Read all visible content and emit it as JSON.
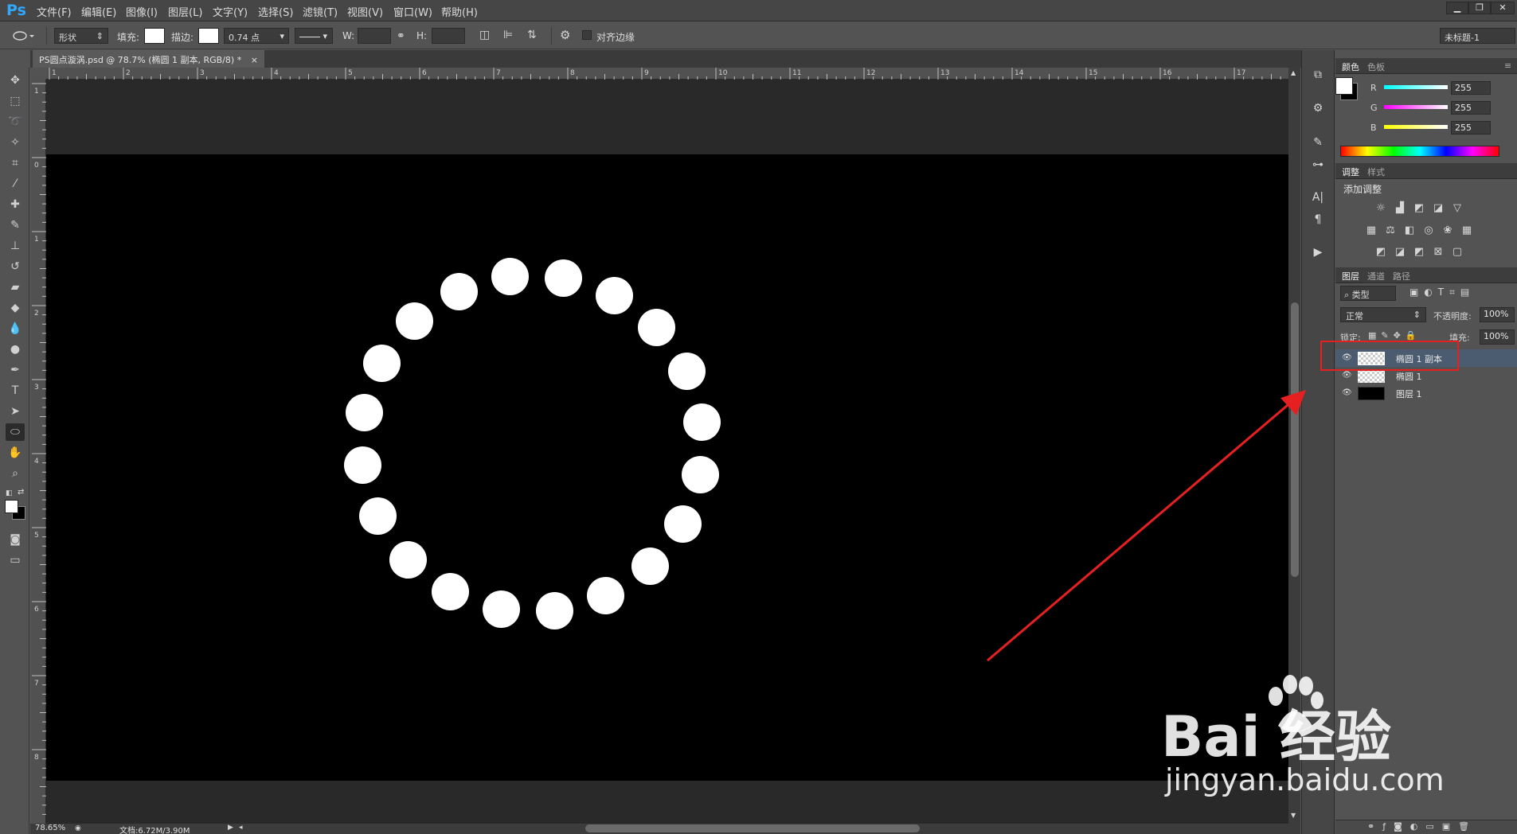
{
  "app": {
    "logo": "Ps"
  },
  "menu": [
    "文件(F)",
    "编辑(E)",
    "图像(I)",
    "图层(L)",
    "文字(Y)",
    "选择(S)",
    "滤镜(T)",
    "视图(V)",
    "窗口(W)",
    "帮助(H)"
  ],
  "window_controls": [
    "▁",
    "❐",
    "✕"
  ],
  "options": {
    "mode": "形状",
    "fill_label": "填充:",
    "stroke_label": "描边:",
    "stroke_width": "0.74 点",
    "w_label": "W:",
    "h_label": "H:",
    "align_edges": "对齐边缘",
    "workspace": "未标题-1"
  },
  "document": {
    "tab_title": "PS圆点漩涡.psd @ 78.7% (椭圆 1 副本, RGB/8) *",
    "close": "×",
    "zoom": "78.65%",
    "doc_size": "文档:6.72M/3.90M"
  },
  "ruler": {
    "horizontal": [
      "1",
      "2",
      "3",
      "4",
      "5",
      "6",
      "7",
      "8",
      "9",
      "10",
      "11",
      "12",
      "13",
      "14",
      "15",
      "16",
      "17"
    ],
    "vertical": [
      "1",
      "0",
      "1",
      "2",
      "3",
      "4",
      "5",
      "6",
      "7",
      "8"
    ]
  },
  "color_panel": {
    "tabs": [
      "颜色",
      "色板"
    ],
    "channels": [
      {
        "label": "R",
        "value": "255"
      },
      {
        "label": "G",
        "value": "255"
      },
      {
        "label": "B",
        "value": "255"
      }
    ]
  },
  "adjust_panel": {
    "tabs": [
      "调整",
      "样式"
    ],
    "title": "添加调整"
  },
  "layers_panel": {
    "tabs": [
      "图层",
      "通道",
      "路径"
    ],
    "filter_kind": "类型",
    "blend_mode": "正常",
    "opacity_label": "不透明度:",
    "opacity": "100%",
    "lock_label": "锁定:",
    "fill_label": "填充:",
    "fill": "100%",
    "layers": [
      {
        "name": "椭圆 1 副本",
        "selected": true,
        "thumb": "transparent"
      },
      {
        "name": "椭圆 1",
        "selected": false,
        "thumb": "transparent"
      },
      {
        "name": "图层 1",
        "selected": false,
        "thumb": "black"
      }
    ]
  },
  "watermark": {
    "brand": "Bai 经验",
    "url": "jingyan.baidu.com"
  },
  "colors": {
    "accent": "#31a8ff",
    "annotation": "#e62020",
    "canvas": "#000000",
    "dot": "#ffffff"
  }
}
